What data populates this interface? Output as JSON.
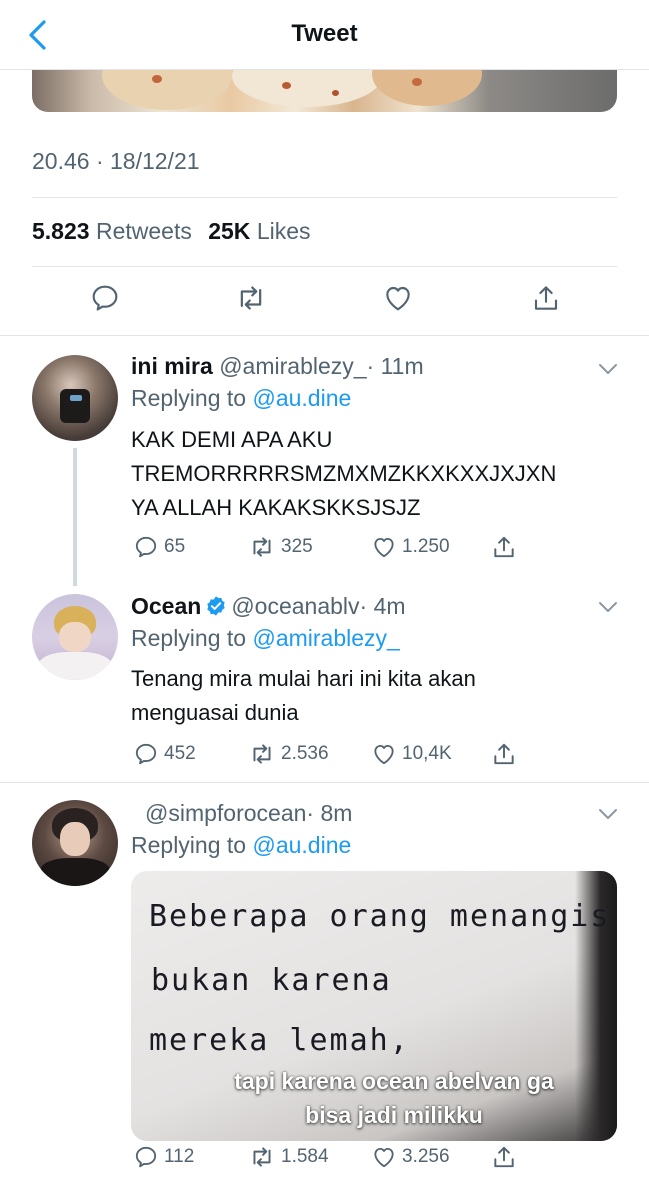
{
  "header": {
    "title": "Tweet"
  },
  "main_tweet": {
    "timestamp": "20.46 · 18/12/21",
    "retweets_count": "5.823",
    "retweets_label": "Retweets",
    "likes_count": "25K",
    "likes_label": "Likes"
  },
  "replies": [
    {
      "name": "ini mira",
      "handle": "@amirablezy_",
      "time": "· 11m",
      "replying_label": "Replying to",
      "replying_to": "@au.dine",
      "text_lines": [
        "KAK DEMI APA AKU",
        "TREMORRRRRSMZMXMZKKXKXXJXJXN",
        "YA ALLAH KAKAKSKKSJSJZ"
      ],
      "replies_count": "65",
      "retweets_count": "325",
      "likes_count": "1.250"
    },
    {
      "name": "Ocean",
      "verified": true,
      "handle": "@oceanablv",
      "time": "· 4m",
      "replying_label": "Replying to",
      "replying_to": "@amirablezy_",
      "text_lines": [
        "Tenang mira mulai hari ini kita akan",
        "menguasai dunia"
      ],
      "replies_count": "452",
      "retweets_count": "2.536",
      "likes_count": "10,4K"
    },
    {
      "name": "",
      "handle": "@simpforocean",
      "time": "· 8m",
      "replying_label": "Replying to",
      "replying_to": "@au.dine",
      "image": {
        "handwriting": [
          "Beberapa orang menangis",
          "bukan karena",
          "mereka lemah,"
        ],
        "caption": [
          "tapi karena ocean abelvan ga",
          "bisa jadi milikku"
        ]
      },
      "replies_count": "112",
      "retweets_count": "1.584",
      "likes_count": "3.256"
    }
  ],
  "colors": {
    "accent": "#1d9bf0",
    "secondary_text": "#536471",
    "border": "#e1e4e6"
  },
  "icons": [
    "back-chevron-icon",
    "reply-icon",
    "retweet-icon",
    "like-icon",
    "share-icon",
    "verified-badge-icon",
    "chevron-down-icon"
  ]
}
